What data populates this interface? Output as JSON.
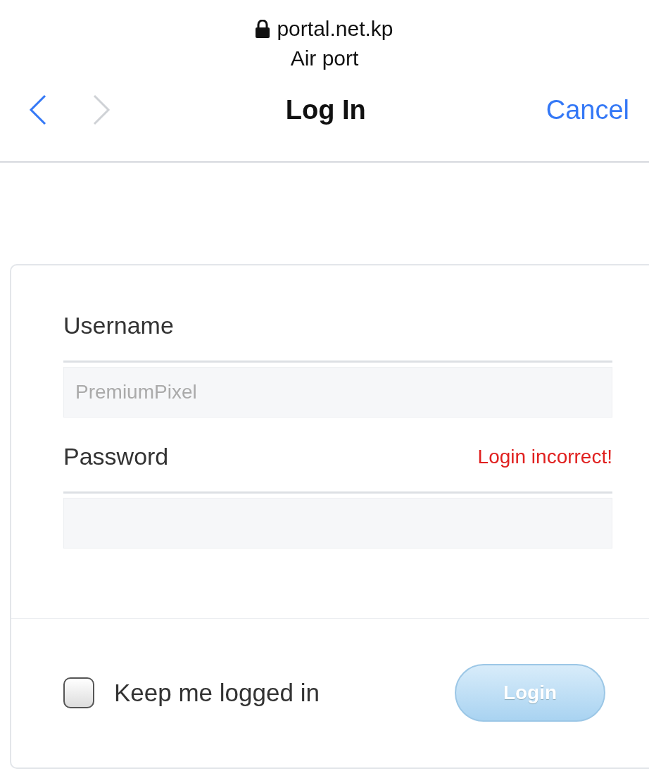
{
  "browser": {
    "url": "portal.net.kp",
    "subtitle": "Air port"
  },
  "nav": {
    "back": {
      "disabled": false
    },
    "forward": {
      "disabled": true
    },
    "title": "Log In",
    "cancel": "Cancel"
  },
  "form": {
    "fields": [
      {
        "label": "Username",
        "placeholder": "PremiumPixel"
      },
      {
        "label": "Password",
        "error": "Login incorrect!"
      }
    ],
    "keep_logged_in": {
      "label": "Keep me logged in",
      "checked": false
    },
    "login_button": {
      "label": "Login",
      "disabled": true
    }
  }
}
